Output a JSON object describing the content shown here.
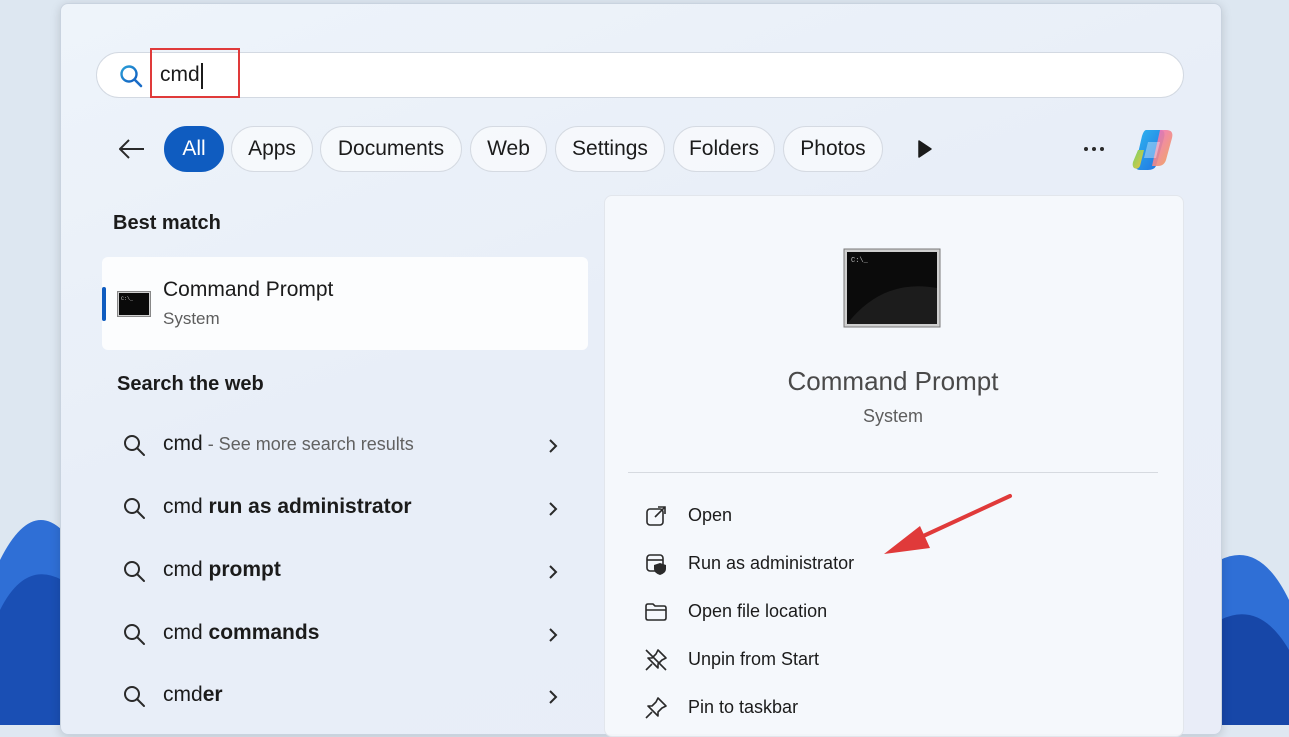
{
  "search": {
    "query": "cmd"
  },
  "filters": [
    "All",
    "Apps",
    "Documents",
    "Web",
    "Settings",
    "Folders",
    "Photos"
  ],
  "best_match": {
    "heading": "Best match",
    "name": "Command Prompt",
    "subtitle": "System"
  },
  "web": {
    "heading": "Search the web",
    "results": [
      {
        "query": "cmd",
        "bold": "",
        "hint": " - See more search results"
      },
      {
        "query": "cmd ",
        "bold": "run as administrator",
        "hint": ""
      },
      {
        "query": "cmd ",
        "bold": "prompt",
        "hint": ""
      },
      {
        "query": "cmd ",
        "bold": "commands",
        "hint": ""
      },
      {
        "query": "cmd",
        "bold": "er",
        "hint": ""
      }
    ]
  },
  "detail": {
    "name": "Command Prompt",
    "subtitle": "System",
    "actions": [
      {
        "label": "Open",
        "icon": "open-external-icon"
      },
      {
        "label": "Run as administrator",
        "icon": "shield-admin-icon"
      },
      {
        "label": "Open file location",
        "icon": "folder-icon"
      },
      {
        "label": "Unpin from Start",
        "icon": "unpin-icon"
      },
      {
        "label": "Pin to taskbar",
        "icon": "pin-icon"
      }
    ]
  },
  "colors": {
    "accent": "#0f5cc0",
    "annotation": "#e03a3a"
  }
}
